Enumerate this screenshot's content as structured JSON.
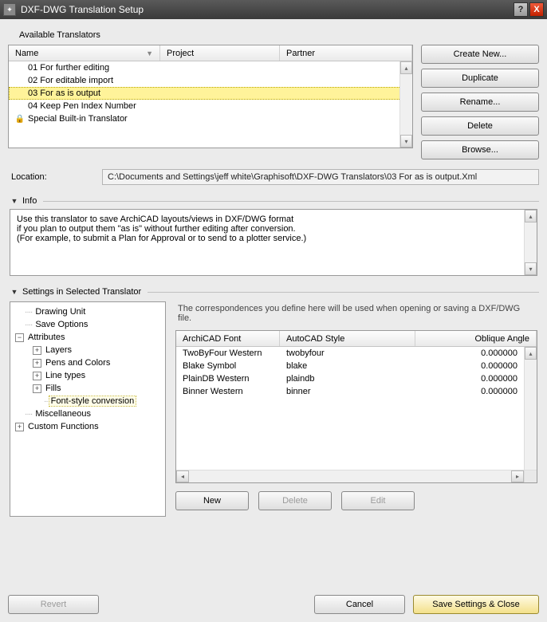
{
  "window": {
    "title": "DXF-DWG Translation Setup"
  },
  "available": {
    "label": "Available Translators",
    "columns": {
      "name": "Name",
      "project": "Project",
      "partner": "Partner"
    },
    "rows": [
      {
        "name": "01 For further editing",
        "locked": false
      },
      {
        "name": "02 For editable import",
        "locked": false
      },
      {
        "name": "03 For as is output",
        "locked": false,
        "selected": true
      },
      {
        "name": "04 Keep Pen Index Number",
        "locked": false
      },
      {
        "name": "Special Built-in Translator",
        "locked": true
      }
    ]
  },
  "side_buttons": {
    "create": "Create New...",
    "duplicate": "Duplicate",
    "rename": "Rename...",
    "delete": "Delete",
    "browse": "Browse..."
  },
  "location": {
    "label": "Location:",
    "value": "C:\\Documents and Settings\\jeff white\\Graphisoft\\DXF-DWG Translators\\03 For as is output.Xml"
  },
  "info": {
    "header": "Info",
    "line1": "Use this translator to save ArchiCAD layouts/views in DXF/DWG format",
    "line2": "if you plan to output them \"as is\" without further editing after conversion.",
    "line3": "(For example, to submit a Plan for Approval or to send to a plotter service.)"
  },
  "settings": {
    "header": "Settings in Selected Translator",
    "tree": {
      "drawing_unit": "Drawing Unit",
      "save_options": "Save Options",
      "attributes": "Attributes",
      "layers": "Layers",
      "pens": "Pens and Colors",
      "linetypes": "Line types",
      "fills": "Fills",
      "fontstyle": "Font-style conversion",
      "misc": "Miscellaneous",
      "custom": "Custom Functions"
    },
    "desc": "The correspondences you define here will be used when opening or saving a DXF/DWG file.",
    "font_table": {
      "cols": {
        "acad": "ArchiCAD Font",
        "style": "AutoCAD Style",
        "angle": "Oblique Angle"
      },
      "rows": [
        {
          "f": "TwoByFour Western",
          "s": "twobyfour",
          "a": "0.000000"
        },
        {
          "f": "Blake Symbol",
          "s": "blake",
          "a": "0.000000"
        },
        {
          "f": "PlainDB Western",
          "s": "plaindb",
          "a": "0.000000"
        },
        {
          "f": "Binner Western",
          "s": "binner",
          "a": "0.000000"
        }
      ]
    },
    "under": {
      "new": "New",
      "delete": "Delete",
      "edit": "Edit"
    }
  },
  "bottom": {
    "revert": "Revert",
    "cancel": "Cancel",
    "save": "Save Settings & Close"
  }
}
